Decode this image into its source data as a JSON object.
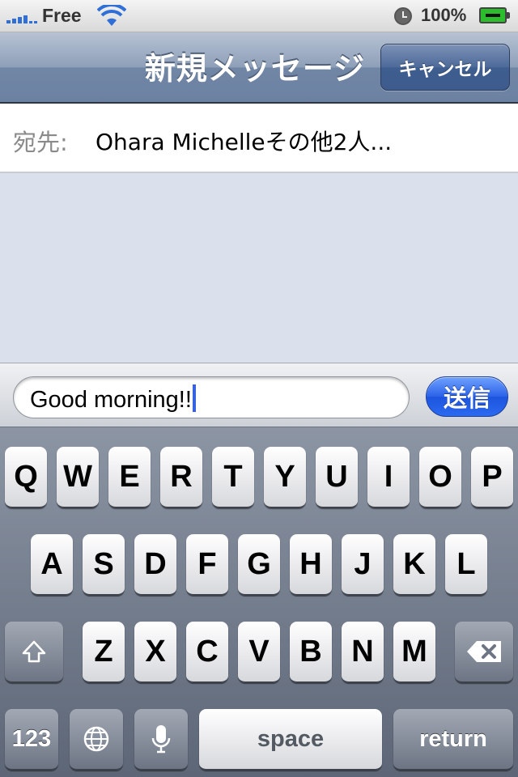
{
  "status_bar": {
    "carrier": "Free",
    "battery": "100%",
    "icons": [
      "signal-icon",
      "wifi-icon",
      "clock-icon",
      "battery-icon"
    ]
  },
  "nav": {
    "title": "新規メッセージ",
    "cancel_label": "キャンセル"
  },
  "to_field": {
    "label": "宛先:",
    "value": "Ohara Michelleその他2人..."
  },
  "compose": {
    "text": "Good morning!!",
    "send_label": "送信"
  },
  "keyboard": {
    "row1": [
      "Q",
      "W",
      "E",
      "R",
      "T",
      "Y",
      "U",
      "I",
      "O",
      "P"
    ],
    "row2": [
      "A",
      "S",
      "D",
      "F",
      "G",
      "H",
      "J",
      "K",
      "L"
    ],
    "row3": [
      "Z",
      "X",
      "C",
      "V",
      "B",
      "N",
      "M"
    ],
    "numbers_label": "123",
    "space_label": "space",
    "return_label": "return",
    "icons": [
      "shift-icon",
      "backspace-icon",
      "globe-icon",
      "microphone-icon"
    ]
  },
  "colors": {
    "nav_bar": "#7186a5",
    "send_button": "#2b62e8",
    "caret": "#3862e0",
    "message_background": "#dbe1ec"
  }
}
